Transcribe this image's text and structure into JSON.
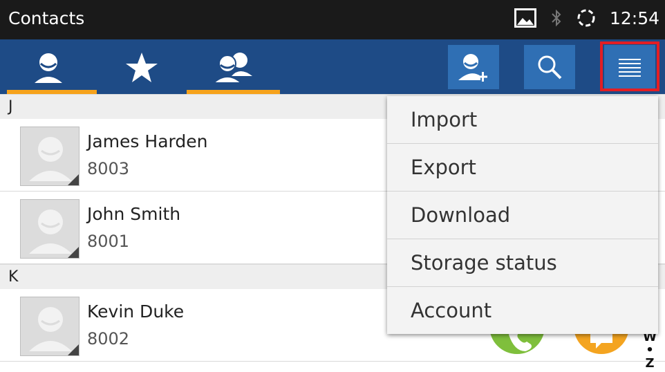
{
  "statusbar": {
    "title": "Contacts",
    "time": "12:54"
  },
  "tabs": [
    {
      "icon": "person-icon"
    },
    {
      "icon": "star-icon"
    },
    {
      "icon": "group-icon"
    }
  ],
  "actions": {
    "add": "add-contact-icon",
    "search": "search-icon",
    "menu": "menu-icon"
  },
  "list": {
    "sections": [
      {
        "letter": "J",
        "contacts": [
          {
            "name": "James Harden",
            "number": "8003"
          },
          {
            "name": "John Smith",
            "number": "8001"
          }
        ]
      },
      {
        "letter": "K",
        "contacts": [
          {
            "name": "Kevin Duke",
            "number": "8002"
          }
        ]
      }
    ]
  },
  "menu": {
    "items": [
      "Import",
      "Export",
      "Download",
      "Storage status",
      "Account"
    ]
  },
  "scroll_index": {
    "top": "W",
    "dot": "•",
    "bottom": "Z"
  },
  "colors": {
    "actionbar": "#1e4b86",
    "accent": "#f6a21b",
    "highlight": "#e31e24"
  }
}
